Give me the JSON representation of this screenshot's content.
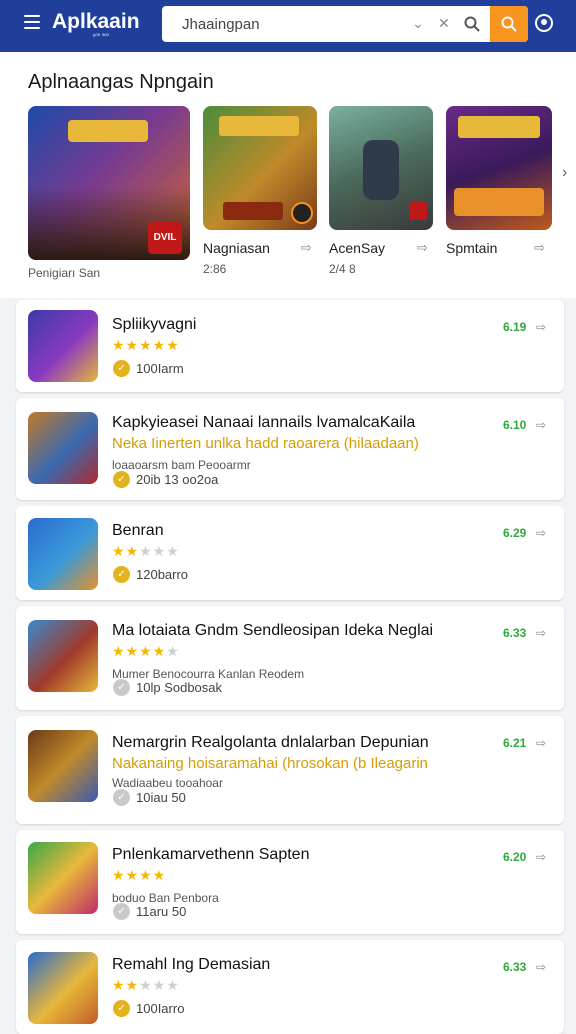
{
  "header": {
    "brand": "Aplkaain",
    "brand_sub": "ᵉ⁰⁰ ⁰⁰⁰",
    "search_value": "Jhaaingpan",
    "clear_glyph": "✕",
    "filter_glyph": "⚲"
  },
  "colors": {
    "header_bg": "#1f3f9b",
    "search_button": "#f7941d",
    "version_green": "#2eaa3a",
    "star": "#f5b800"
  },
  "featured": {
    "title": "Aplnaangas Npngain",
    "items": [
      {
        "name": "",
        "meta": "Penigiarı San",
        "icon": "game-art",
        "badge": "DVIL"
      },
      {
        "name": "Nagniasan",
        "meta": "2:86",
        "icon": "game-art"
      },
      {
        "name": "AcenSay",
        "meta": "2/4 8",
        "icon": "game-art"
      },
      {
        "name": "Spmtain",
        "meta": "",
        "icon": "game-art"
      }
    ]
  },
  "apps": [
    {
      "title": "Spliikyvagni",
      "subtitle": "",
      "desc": "",
      "rating": 5,
      "downloads": "100Iarm",
      "version": "6.19",
      "verified": true
    },
    {
      "title": "Kapkyieasei Nanaai lannails lvamalcaKaila",
      "subtitle": "Neka Iinerten unlka hadd raoarera (hilaadaan)",
      "desc": "loaaoarsm bam Peooarmr",
      "rating": 0,
      "downloads": "20ib 13 oo2oa",
      "version": "6.10",
      "verified": true
    },
    {
      "title": "Benran",
      "subtitle": "",
      "desc": "",
      "rating": 2,
      "downloads": "120barro",
      "version": "6.29",
      "verified": true
    },
    {
      "title": "Ma lotaiata Gndm Sendleosipan Ideka Neglai",
      "subtitle": "",
      "desc": "Mumer Benocourra Kanlan Reodem",
      "rating": 4,
      "downloads": "10lp Sodbosak",
      "version": "6.33",
      "verified": false
    },
    {
      "title": "Nemargrin Realgolanta dnlalarban Depunian",
      "subtitle": "Nakanaing hoisaramahai (hrosokan (b Ileagarin",
      "desc": "Wadiaabeu tooahoar",
      "rating": 0,
      "downloads": "10iau 50",
      "version": "6.21",
      "verified": false
    },
    {
      "title": "Pnlenkamarvethenn Sapten",
      "subtitle": "",
      "desc": "boduo Ban Penbora",
      "rating": 4,
      "downloads": "11aru 50",
      "version": "6.20",
      "verified": false
    },
    {
      "title": "Remahl Ing Demasian",
      "subtitle": "",
      "desc": "",
      "rating": 2,
      "downloads": "100Iarro",
      "version": "6.33",
      "verified": true
    }
  ]
}
